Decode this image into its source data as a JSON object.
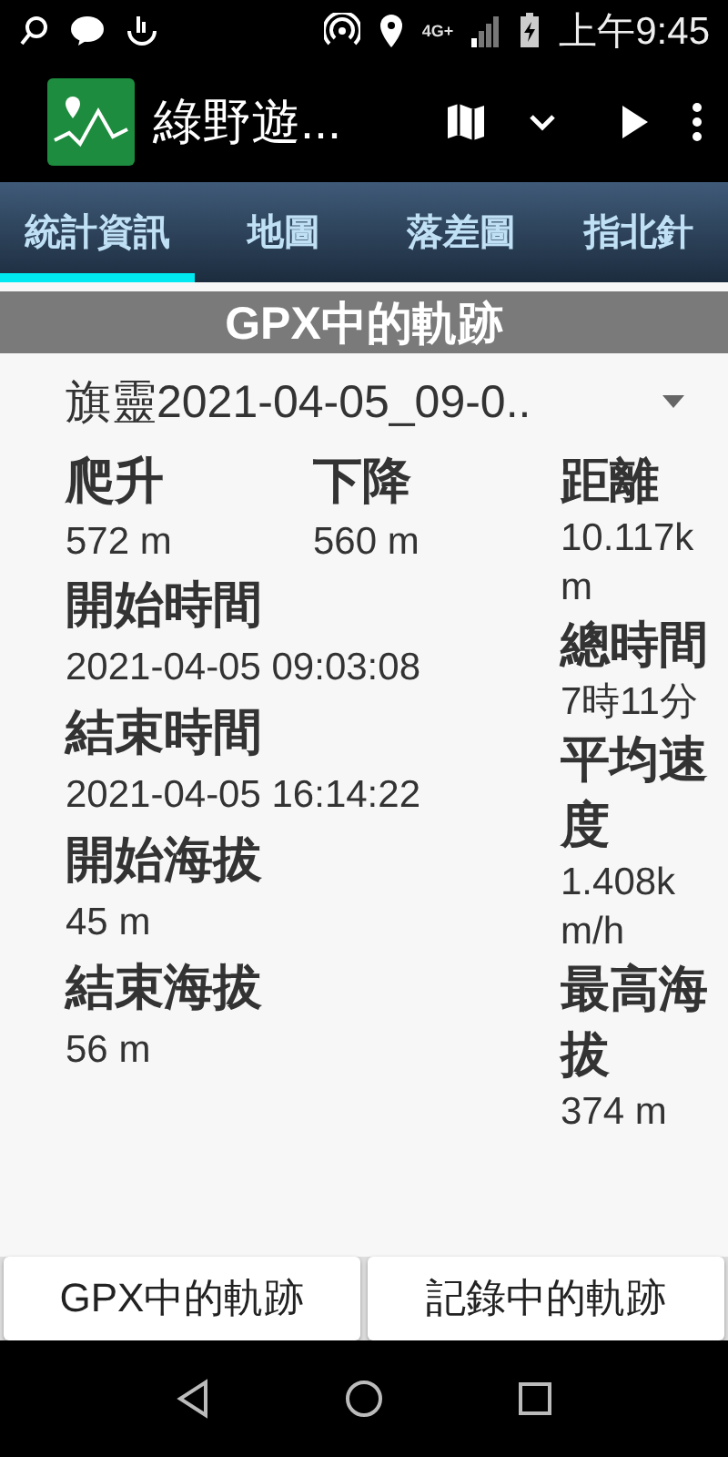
{
  "status_bar": {
    "network": "4G+",
    "time": "上午9:45"
  },
  "app_bar": {
    "title": "綠野遊..."
  },
  "tabs": [
    {
      "label": "統計資訊",
      "selected": true
    },
    {
      "label": "地圖",
      "selected": false
    },
    {
      "label": "落差圖",
      "selected": false
    },
    {
      "label": "指北針",
      "selected": false
    }
  ],
  "section_header": "GPX中的軌跡",
  "track_select": {
    "value": "旗靈2021-04-05_09-0.."
  },
  "stats": {
    "top": [
      {
        "label": "爬升",
        "value": "572 m"
      },
      {
        "label": "下降",
        "value": "560 m"
      }
    ],
    "left": [
      {
        "label": "開始時間",
        "value": "2021-04-05 09:03:08"
      },
      {
        "label": "結束時間",
        "value": "2021-04-05 16:14:22"
      },
      {
        "label": "開始海拔",
        "value": "45 m"
      },
      {
        "label": "結束海拔",
        "value": "56 m"
      }
    ],
    "right": [
      {
        "label": "距離",
        "value": "10.117km"
      },
      {
        "label": "總時間",
        "value": "7時11分"
      },
      {
        "label": "平均速度",
        "value": "1.408km/h"
      },
      {
        "label": "最高海拔",
        "value": "374 m"
      }
    ]
  },
  "bottom_buttons": [
    {
      "label": "GPX中的軌跡"
    },
    {
      "label": "記錄中的軌跡"
    }
  ]
}
